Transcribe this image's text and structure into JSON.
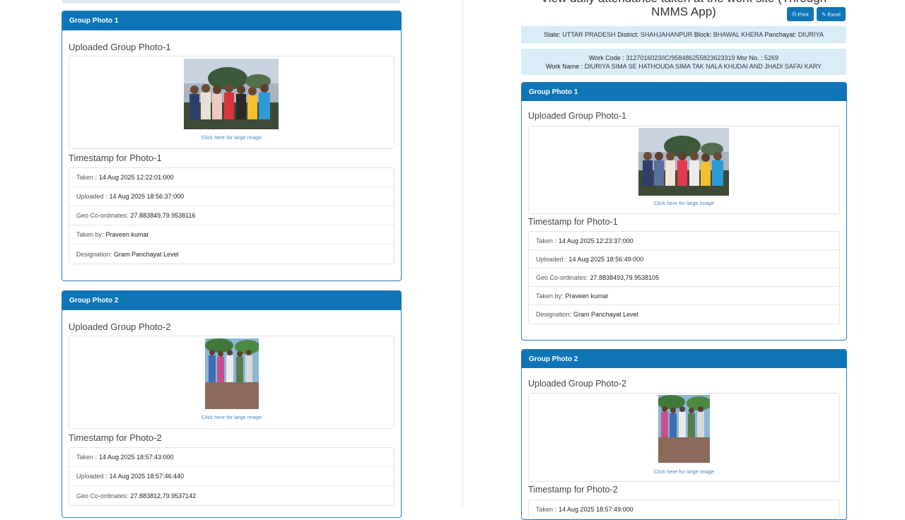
{
  "left": {
    "group1": {
      "header": "Group Photo 1",
      "uploaded_title": "Uploaded Group Photo-1",
      "link": "Click here for large image",
      "timestamp_title": "Timestamp for Photo-1",
      "rows": [
        {
          "label": "Taken :",
          "value": "14 Aug 2025 12:22:01:000"
        },
        {
          "label": "Uploaded :",
          "value": "14 Aug 2025 18:56:37:000"
        },
        {
          "label": "Geo Co-ordinates:",
          "value": "27.883849,79.9538116"
        },
        {
          "label": "Taken by:",
          "value": "Praveen kumar"
        },
        {
          "label": "Designation:",
          "value": "Gram Panchayat Level"
        }
      ]
    },
    "group2": {
      "header": "Group Photo 2",
      "uploaded_title": "Uploaded Group Photo-2",
      "link": "Click here for large image",
      "timestamp_title": "Timestamp for Photo-2",
      "rows": [
        {
          "label": "Taken :",
          "value": "14 Aug 2025 18:57:43:000"
        },
        {
          "label": "Uploaded :",
          "value": "14 Aug 2025 18:57:46:440"
        },
        {
          "label": "Geo Co-ordinates:",
          "value": "27.883812,79.9537142"
        }
      ]
    }
  },
  "right": {
    "title": "View daily attendance taken at the work site (Through NMMS App)",
    "print_label": "Print",
    "excel_label": "Excel",
    "location": {
      "state_label": "State:",
      "state": "UTTAR PRADESH",
      "district_label": "District:",
      "district": "SHAHJAHANPUR",
      "block_label": "Block:",
      "block": "BHAWAL KHERA",
      "panchayat_label": "Panchayat:",
      "panchayat": "DIURIYA"
    },
    "work": {
      "code_label": "Work Code :",
      "code": "3127016023/IC/958486255823623319",
      "msr_label": "Msr No. :",
      "msr": "5269",
      "name_label": "Work Name :",
      "name": "DIURIYA SIMA SE HATHOUDA SIMA TAK NALA KHUDAI AND JHADI SAFAI KARY"
    },
    "group1": {
      "header": "Group Photo 1",
      "uploaded_title": "Uploaded Group Photo-1",
      "link": "Click here for large image",
      "timestamp_title": "Timestamp for Photo-1",
      "rows": [
        {
          "label": "Taken :",
          "value": "14 Aug 2025 12:23:37:000"
        },
        {
          "label": "Uploaded :",
          "value": "14 Aug 2025 18:56:49:000"
        },
        {
          "label": "Geo Co-ordinates:",
          "value": "27.8838493,79.9538105"
        },
        {
          "label": "Taken by:",
          "value": "Praveen kumar"
        },
        {
          "label": "Designation:",
          "value": "Gram Panchayat Level"
        }
      ]
    },
    "group2": {
      "header": "Group Photo 2",
      "uploaded_title": "Uploaded Group Photo-2",
      "link": "Click here for large image",
      "timestamp_title": "Timestamp for Photo-2",
      "rows": [
        {
          "label": "Taken :",
          "value": "14 Aug 2025 18:57:49:000"
        }
      ]
    }
  },
  "colors": {
    "header_blue": "#0f75b6",
    "info_bg": "#d9ecf7",
    "link": "#4b86b4"
  }
}
